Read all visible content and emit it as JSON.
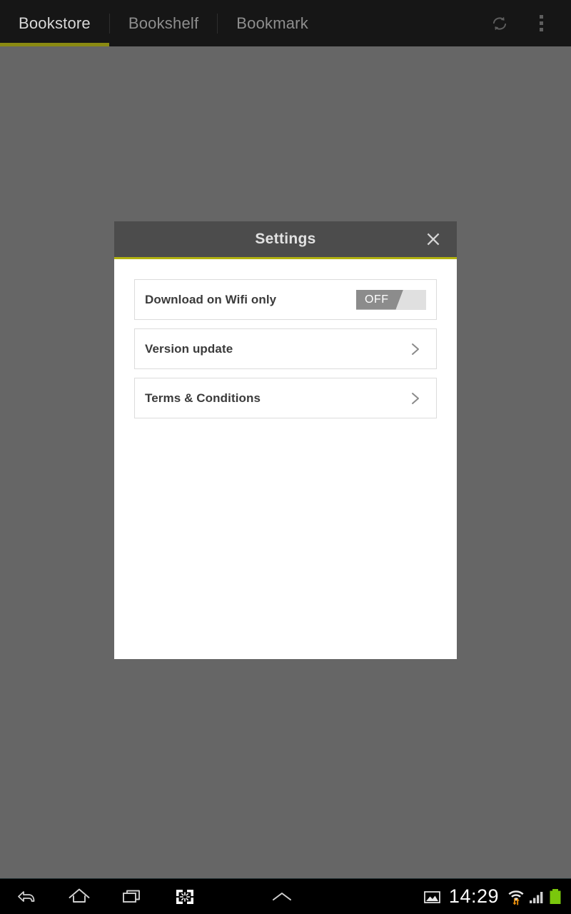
{
  "topbar": {
    "tabs": [
      {
        "label": "Bookstore",
        "active": true
      },
      {
        "label": "Bookshelf",
        "active": false
      },
      {
        "label": "Bookmark",
        "active": false
      }
    ],
    "actions": [
      {
        "name": "refresh-icon",
        "label": "Refresh"
      },
      {
        "name": "overflow-menu-icon",
        "label": "More options"
      }
    ],
    "background_color": "#161616",
    "active_tab_underline_color": "#8a8a12",
    "active_tab_text_color": "#d8d8d8",
    "inactive_tab_text_color": "#8e8e8e"
  },
  "backdrop": {
    "color": "#666666"
  },
  "dialog": {
    "title": "Settings",
    "close_label": "Close",
    "header_color": "#4c4c4c",
    "accent_color": "#b2b211",
    "body_color": "#ffffff",
    "rows": [
      {
        "label": "Download on Wifi only",
        "control": "toggle",
        "toggle_value": "OFF",
        "toggle_on": false,
        "toggle_off_color": "#8c8c8c",
        "toggle_track_color": "#e0e0e0"
      },
      {
        "label": "Version update",
        "control": "chevron",
        "chevron": "chevron-right-icon"
      },
      {
        "label": "Terms & Conditions",
        "control": "chevron",
        "chevron": "chevron-right-icon"
      }
    ]
  },
  "systembar": {
    "nav": [
      {
        "name": "back-icon",
        "label": "Back"
      },
      {
        "name": "home-icon",
        "label": "Home"
      },
      {
        "name": "recents-icon",
        "label": "Recent apps"
      },
      {
        "name": "screenshot-icon",
        "label": "Screen capture"
      },
      {
        "name": "chevron-up-icon",
        "label": "Expand"
      }
    ],
    "status": {
      "image_icon": "image-icon",
      "time": "14:29",
      "wifi_icon": "wifi-transfer-icon",
      "signal_icon": "cellular-signal-icon",
      "battery_icon": "battery-full-icon",
      "battery_color": "#7ac70c",
      "wifi_arrow_color": "#f0930c"
    }
  }
}
